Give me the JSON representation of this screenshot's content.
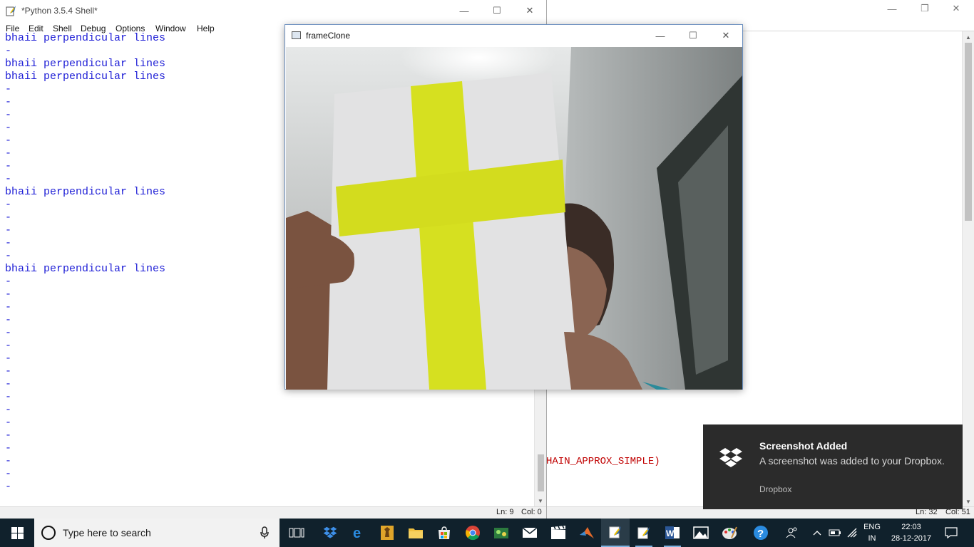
{
  "background_window": {
    "code_fragment": "HAIN_APPROX_SIMPLE)",
    "status_line": "Ln: 32",
    "status_col": "Col: 51"
  },
  "shell": {
    "title": "*Python 3.5.4 Shell*",
    "menu": [
      "File",
      "Edit",
      "Shell",
      "Debug",
      "Options",
      "Window",
      "Help"
    ],
    "lines": [
      "bhaii perpendicular lines",
      "-",
      "bhaii perpendicular lines",
      "bhaii perpendicular lines",
      "-",
      "-",
      "-",
      "-",
      "-",
      "-",
      "-",
      "-",
      "bhaii perpendicular lines",
      "-",
      "-",
      "-",
      "-",
      "-",
      "bhaii perpendicular lines",
      "-",
      "-",
      "-",
      "-",
      "-",
      "-",
      "-",
      "-",
      "-",
      "-",
      "-",
      "-",
      "-",
      "-",
      "-",
      "-",
      "-"
    ],
    "status_line": "Ln: 9",
    "status_col": "Col: 0"
  },
  "frame_window": {
    "title": "frameClone"
  },
  "toast": {
    "title": "Screenshot Added",
    "body": "A screenshot was added to your Dropbox.",
    "source": "Dropbox"
  },
  "taskbar": {
    "search_placeholder": "Type here to search",
    "apps": [
      "task-view-icon",
      "dropbox-icon",
      "edge-icon",
      "chess-app-icon",
      "file-explorer-icon",
      "store-icon",
      "chrome-icon",
      "media-app-icon",
      "mail-icon",
      "video-editor-icon",
      "matlab-icon",
      "python-idle-icon",
      "python-idle-icon",
      "word-icon",
      "photos-icon",
      "paint-icon",
      "help-icon"
    ],
    "lang_top": "ENG",
    "lang_bottom": "IN",
    "time": "22:03",
    "date": "28-12-2017"
  },
  "colors": {
    "shell_text": "#1d1dd6",
    "code_red": "#c00000",
    "taskbar": "#10212c",
    "toast_bg": "#2b2b2b",
    "paper_yellow": "#d6e020"
  }
}
